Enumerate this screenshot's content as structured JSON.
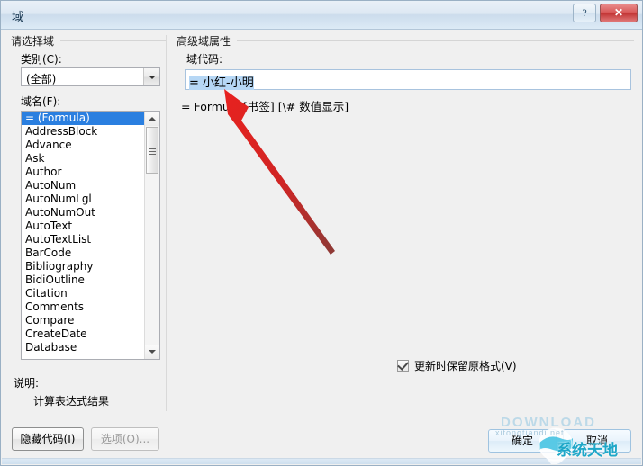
{
  "window": {
    "title": "域",
    "help_button": "?",
    "close_button": "✕"
  },
  "left_panel": {
    "group_title": "请选择域",
    "category_label": "类别(C):",
    "category_value": "(全部)",
    "fieldname_label": "域名(F):",
    "field_items": [
      "= (Formula)",
      "AddressBlock",
      "Advance",
      "Ask",
      "Author",
      "AutoNum",
      "AutoNumLgl",
      "AutoNumOut",
      "AutoText",
      "AutoTextList",
      "BarCode",
      "Bibliography",
      "BidiOutline",
      "Citation",
      "Comments",
      "Compare",
      "CreateDate",
      "Database"
    ],
    "selected_index": 0,
    "description_label": "说明:",
    "description_text": "计算表达式结果",
    "hide_codes_button": "隐藏代码(I)",
    "options_button": "选项(O)..."
  },
  "right_panel": {
    "group_title": "高级域属性",
    "fieldcode_label": "域代码:",
    "fieldcode_value": "= 小红-小明",
    "fieldcode_hint": "= Formula [书签] [\\# 数值显示]",
    "preserve_format_label": "更新时保留原格式(V)",
    "preserve_format_checked": true
  },
  "footer": {
    "ok_button": "确定",
    "cancel_button": "取消"
  },
  "watermark": {
    "brand": "系统天地",
    "domain": "xitongtiandi.net",
    "top_text": "DOWNLOAD"
  },
  "colors": {
    "selection_blue": "#2a7fe0",
    "text_selection": "#b6d7f5",
    "annotation_red": "#e01b1b",
    "titlebar_blue": "#dde8f3",
    "watermark_cyan": "#1ea7c8"
  }
}
